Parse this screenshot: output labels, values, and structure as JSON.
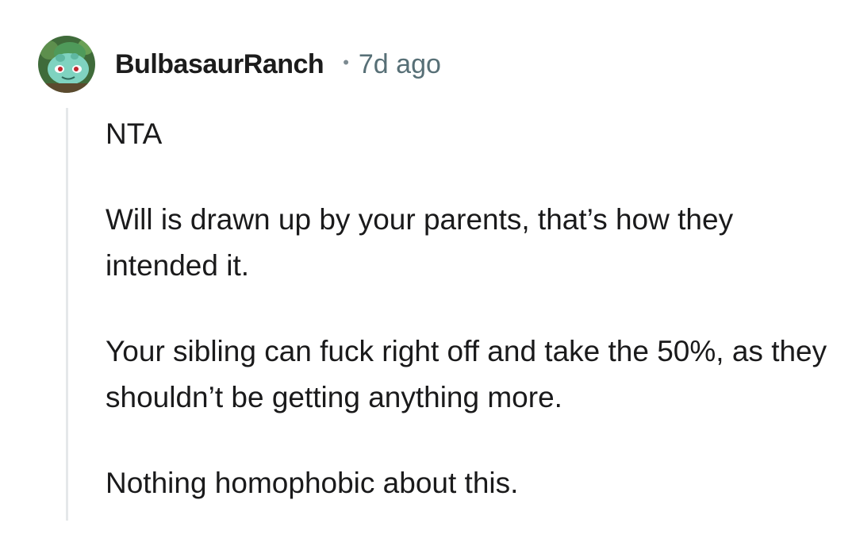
{
  "comment": {
    "author": "BulbasaurRanch",
    "separator": "•",
    "age": "7d ago",
    "avatar_icon": "bulbasaur-avatar-icon",
    "paragraphs": [
      "NTA",
      "Will is drawn up by your parents, that’s how they intended it.",
      "Your sibling can fuck right off and take the 50%, as they shouldn’t be getting anything more.",
      "Nothing homophobic about this."
    ]
  },
  "colors": {
    "author": "#1c1c1c",
    "meta": "#576f76",
    "body_text": "#1a1a1b",
    "thread_line": "#e5e8ea",
    "background": "#ffffff"
  }
}
